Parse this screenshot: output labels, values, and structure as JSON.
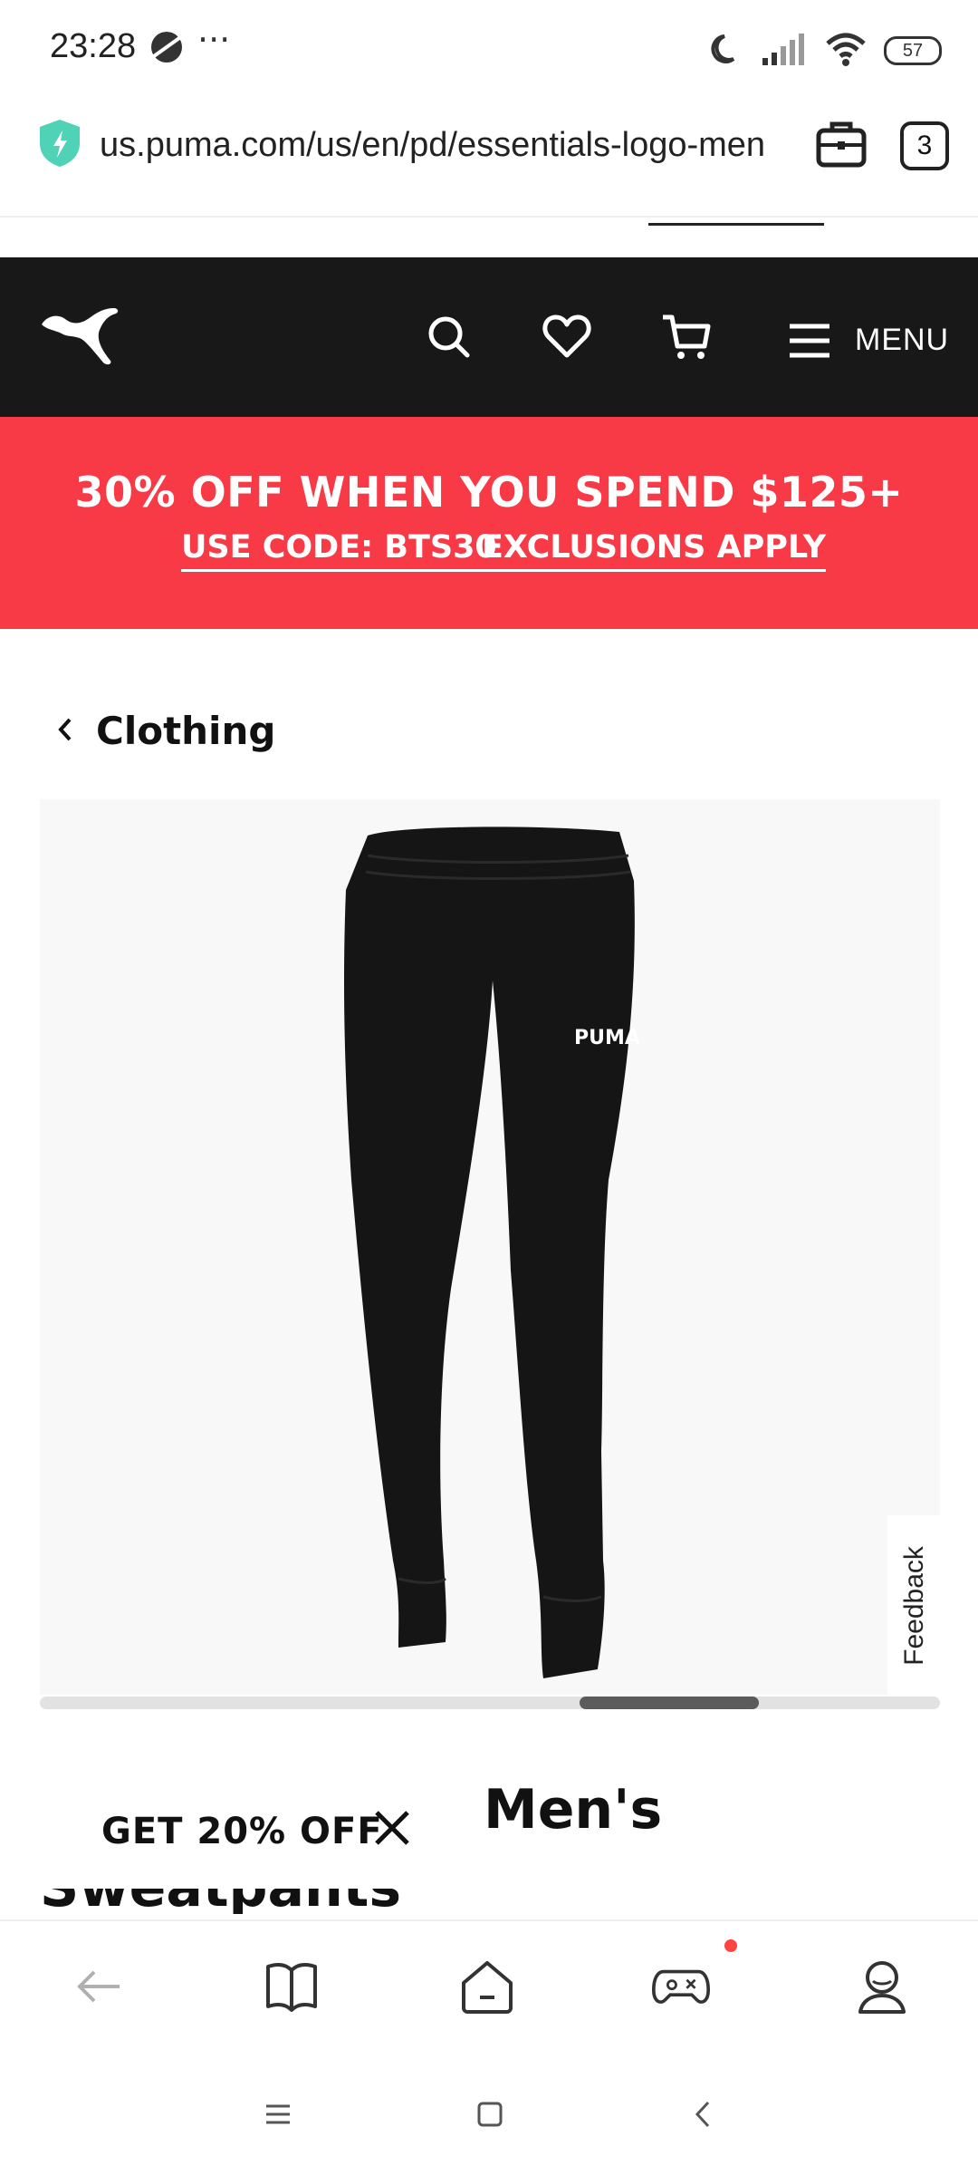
{
  "status_bar": {
    "time": "23:28",
    "dots": "···",
    "battery": "57",
    "icons": [
      "vpn-icon",
      "moon-icon",
      "signal-icon",
      "wifi-icon",
      "battery-icon"
    ]
  },
  "browser": {
    "url": "us.puma.com/us/en/pd/essentials-logo-men",
    "tab_count": "3",
    "icons": [
      "secure-shield-icon",
      "toolbox-icon",
      "tabs-icon"
    ]
  },
  "header": {
    "menu_label": "MENU",
    "icons": [
      "puma-logo",
      "search-icon",
      "heart-icon",
      "cart-icon",
      "hamburger-icon"
    ],
    "background": "#181818"
  },
  "promo": {
    "title": "30% OFF WHEN YOU SPEND $125+",
    "code_link": "USE CODE: BTS30",
    "exclusions_link": "EXCLUSIONS APPLY",
    "background": "#f83a47"
  },
  "breadcrumb": {
    "label": "Clothing"
  },
  "product": {
    "image_alt_icon": "sweatpants-image",
    "image_brand_mark": "PUMA",
    "title_line1": "Men's",
    "title_line2": "Sweatpants",
    "carousel_progress": 0.65
  },
  "feedback": {
    "label": "Feedback"
  },
  "offer_tab": {
    "label": "GET 20% OFF"
  },
  "bottom_nav": {
    "icons": [
      "back-icon",
      "book-icon",
      "home-icon",
      "game-icon",
      "profile-icon"
    ]
  },
  "system_nav": {
    "icons": [
      "recents-icon",
      "home-square-icon",
      "back-chevron-icon"
    ]
  }
}
